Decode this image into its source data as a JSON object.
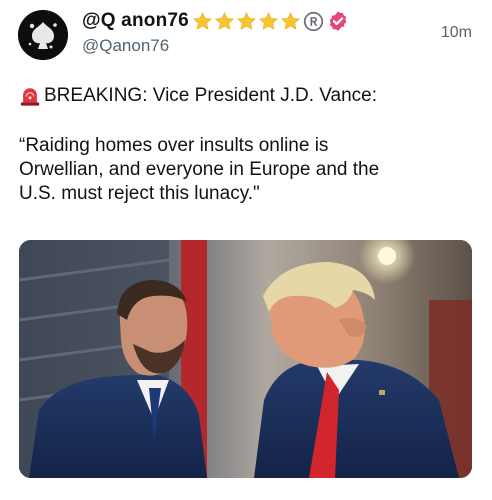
{
  "post": {
    "display_name": "@Q anon76",
    "handle": "@Qanon76",
    "timestamp": "10m",
    "breaking": "BREAKING: Vice President J.D. Vance:",
    "quote_lines": [
      "“Raiding homes over insults online is",
      "Orwellian, and everyone in Europe and the",
      "U.S. must reject this lunacy.\""
    ],
    "badges": [
      "star-emoji",
      "star-emoji",
      "star-emoji",
      "star-emoji",
      "star-emoji",
      "registered-mark",
      "verified-badge"
    ],
    "siren_icon": "siren-emoji"
  },
  "colors": {
    "text": "#0f1419",
    "secondary_text": "#536471",
    "star": "#f7c531",
    "verified": "#e8457a",
    "siren": "#e0353b"
  }
}
